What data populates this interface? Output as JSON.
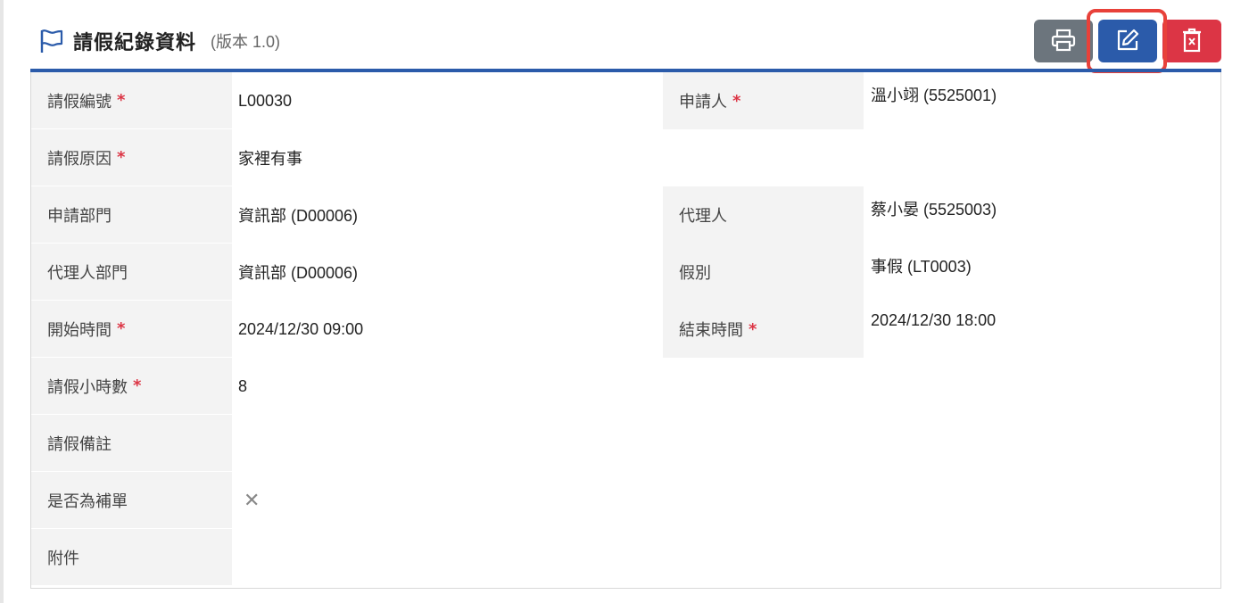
{
  "header": {
    "title": "請假紀錄資料",
    "version": "(版本 1.0)"
  },
  "toolbar": {
    "print_icon": "printer-icon",
    "edit_icon": "edit-icon",
    "delete_icon": "trash-icon"
  },
  "colors": {
    "accent": "#2b5baa",
    "print": "#6c757d",
    "delete": "#dc3545",
    "required": "#dc3545",
    "highlight": "#e8413a"
  },
  "required_mark": "*",
  "fields": {
    "leave_no": {
      "label": "請假編號",
      "value": "L00030"
    },
    "applicant": {
      "label": "申請人",
      "value": "溫小翊 (5525001)"
    },
    "reason": {
      "label": "請假原因",
      "value": "家裡有事"
    },
    "dept": {
      "label": "申請部門",
      "value": "資訊部 (D00006)"
    },
    "agent": {
      "label": "代理人",
      "value": "蔡小晏 (5525003)"
    },
    "agent_dept": {
      "label": "代理人部門",
      "value": "資訊部 (D00006)"
    },
    "leave_type": {
      "label": "假別",
      "value": "事假 (LT0003)"
    },
    "start_time": {
      "label": "開始時間",
      "value": "2024/12/30 09:00"
    },
    "end_time": {
      "label": "結束時間",
      "value": "2024/12/30 18:00"
    },
    "hours": {
      "label": "請假小時數",
      "value": "8"
    },
    "note": {
      "label": "請假備註",
      "value": ""
    },
    "is_supplement": {
      "label": "是否為補單",
      "value": "✕"
    },
    "attachment": {
      "label": "附件",
      "value": ""
    }
  }
}
